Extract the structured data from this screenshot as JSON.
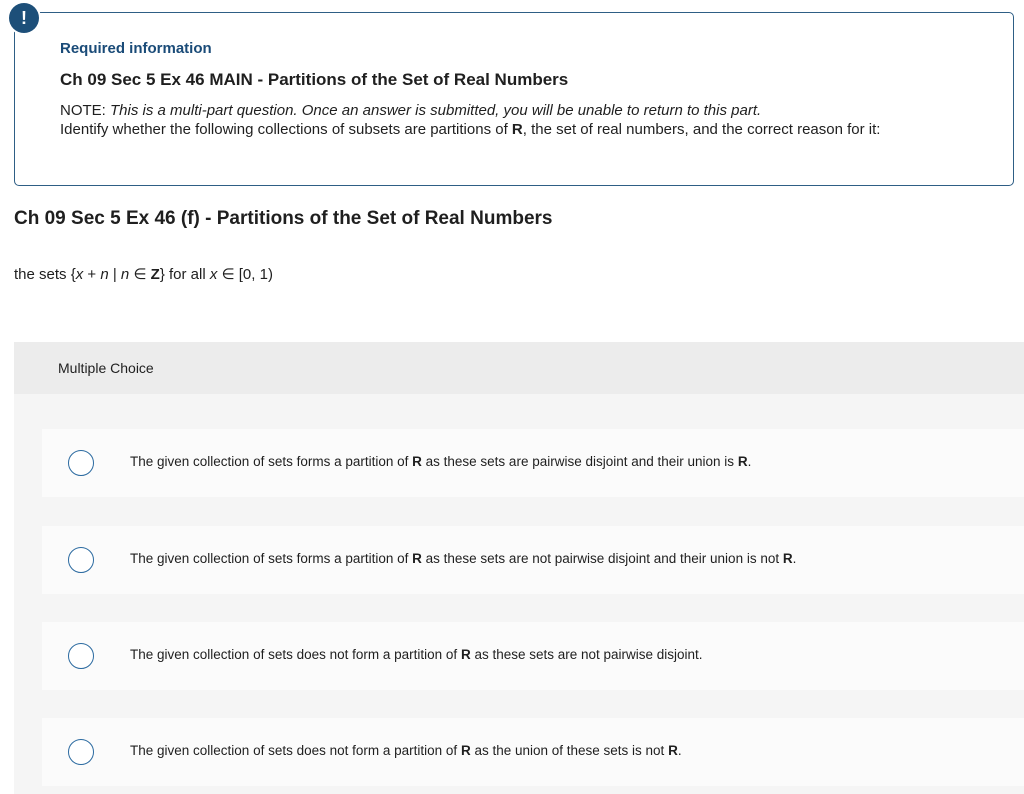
{
  "info": {
    "alert_glyph": "!",
    "required_label": "Required information",
    "main_title": "Ch 09 Sec 5 Ex 46 MAIN - Partitions of the Set of Real Numbers",
    "note_prefix": "NOTE: ",
    "note_italic": "This is a multi-part question. Once an answer is submitted, you will be unable to return to this part.",
    "instruction_pre": "Identify whether the following collections of subsets are partitions of ",
    "instruction_bold": "R",
    "instruction_post": ", the set of real numbers, and the correct reason for it:"
  },
  "question": {
    "title": "Ch 09 Sec 5 Ex 46 (f) - Partitions of the Set of Real Numbers",
    "stem": {
      "p1": "the sets {",
      "x1": "x",
      "p2": " + ",
      "n1": "n",
      "p3": " | ",
      "n2": "n",
      "p4": " ∈ ",
      "z": "Z",
      "p5": "} for all ",
      "x2": "x",
      "p6": " ∈ [0, 1)"
    }
  },
  "multiple_choice": {
    "label": "Multiple Choice",
    "options": [
      {
        "pre": "The given collection of sets forms a partition of ",
        "b1": "R",
        "mid": " as these sets are pairwise disjoint and their union is ",
        "b2": "R",
        "post": "."
      },
      {
        "pre": "The given collection of sets forms a partition of ",
        "b1": "R",
        "mid": " as these sets are not pairwise disjoint and their union is not ",
        "b2": "R",
        "post": "."
      },
      {
        "pre": "The given collection of sets does not form a partition of ",
        "b1": "R",
        "mid": " as these sets are not pairwise disjoint.",
        "b2": "",
        "post": ""
      },
      {
        "pre": "The given collection of sets does not form a partition of ",
        "b1": "R",
        "mid": " as the union of these sets is not ",
        "b2": "R",
        "post": "."
      }
    ]
  },
  "colors": {
    "accent": "#1d4f79",
    "border": "#2e5e85",
    "panel_bg": "#f5f5f5",
    "radio_border": "#2b6aa0"
  }
}
